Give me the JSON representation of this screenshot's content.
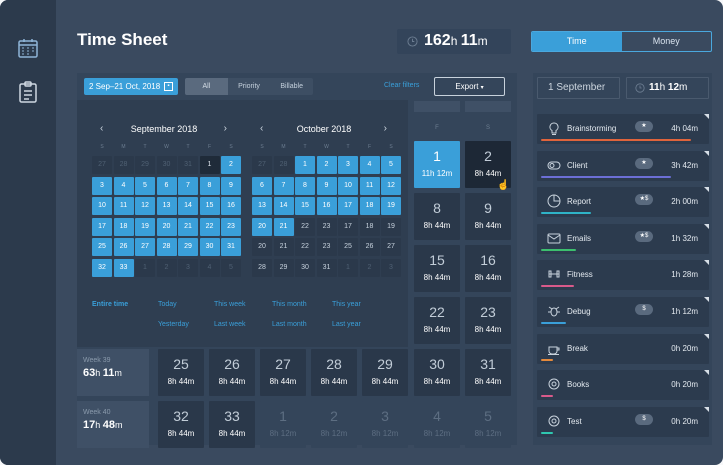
{
  "title": "Time Sheet",
  "total": {
    "hours": "162",
    "minutes": "11"
  },
  "view_toggle": {
    "time": "Time",
    "money": "Money"
  },
  "toolbar": {
    "date_range": "2 Sep–21 Oct, 2018",
    "filters": [
      "All",
      "Priority",
      "Billable"
    ],
    "clear": "Clear filters",
    "export": "Export"
  },
  "cal1": {
    "title": "September 2018",
    "dow": [
      "S",
      "M",
      "T",
      "W",
      "T",
      "F",
      "S"
    ],
    "days": [
      [
        "27",
        "m"
      ],
      [
        "28",
        "m"
      ],
      [
        "29",
        "m"
      ],
      [
        "30",
        "m"
      ],
      [
        "31",
        "m"
      ],
      [
        "1",
        "dk"
      ],
      [
        "2",
        "b"
      ],
      [
        "3",
        "b"
      ],
      [
        "4",
        "b"
      ],
      [
        "5",
        "b"
      ],
      [
        "6",
        "b"
      ],
      [
        "7",
        "b"
      ],
      [
        "8",
        "b"
      ],
      [
        "9",
        "b"
      ],
      [
        "10",
        "b"
      ],
      [
        "11",
        "b"
      ],
      [
        "12",
        "b"
      ],
      [
        "13",
        "b"
      ],
      [
        "14",
        "b"
      ],
      [
        "15",
        "b"
      ],
      [
        "16",
        "b"
      ],
      [
        "17",
        "b"
      ],
      [
        "18",
        "b"
      ],
      [
        "19",
        "b"
      ],
      [
        "20",
        "b"
      ],
      [
        "21",
        "b"
      ],
      [
        "22",
        "b"
      ],
      [
        "23",
        "b"
      ],
      [
        "25",
        "b"
      ],
      [
        "26",
        "b"
      ],
      [
        "27",
        "b"
      ],
      [
        "28",
        "b"
      ],
      [
        "29",
        "b"
      ],
      [
        "30",
        "b"
      ],
      [
        "31",
        "b"
      ],
      [
        "32",
        "b"
      ],
      [
        "33",
        "b"
      ],
      [
        "1",
        "m"
      ],
      [
        "2",
        "m"
      ],
      [
        "3",
        "m"
      ],
      [
        "4",
        "m"
      ],
      [
        "5",
        "m"
      ]
    ]
  },
  "cal2": {
    "title": "October 2018",
    "dow": [
      "S",
      "M",
      "T",
      "W",
      "T",
      "F",
      "S"
    ],
    "days": [
      [
        "27",
        "m"
      ],
      [
        "28",
        "m"
      ],
      [
        "1",
        "b"
      ],
      [
        "2",
        "b"
      ],
      [
        "3",
        "b"
      ],
      [
        "4",
        "b"
      ],
      [
        "5",
        "b"
      ],
      [
        "6",
        "b"
      ],
      [
        "7",
        "b"
      ],
      [
        "8",
        "b"
      ],
      [
        "9",
        "b"
      ],
      [
        "10",
        "b"
      ],
      [
        "11",
        "b"
      ],
      [
        "12",
        "b"
      ],
      [
        "13",
        "b"
      ],
      [
        "14",
        "b"
      ],
      [
        "15",
        "b"
      ],
      [
        "16",
        "b"
      ],
      [
        "17",
        "b"
      ],
      [
        "18",
        "b"
      ],
      [
        "19",
        "b"
      ],
      [
        "20",
        "b"
      ],
      [
        "21",
        "b"
      ],
      [
        "22",
        "n"
      ],
      [
        "23",
        "n"
      ],
      [
        "17",
        "n"
      ],
      [
        "18",
        "n"
      ],
      [
        "19",
        "n"
      ],
      [
        "20",
        "n"
      ],
      [
        "21",
        "n"
      ],
      [
        "22",
        "n"
      ],
      [
        "23",
        "n"
      ],
      [
        "25",
        "n"
      ],
      [
        "26",
        "n"
      ],
      [
        "27",
        "n"
      ],
      [
        "28",
        "n"
      ],
      [
        "29",
        "n"
      ],
      [
        "30",
        "n"
      ],
      [
        "31",
        "n"
      ],
      [
        "1",
        "m"
      ],
      [
        "2",
        "m"
      ],
      [
        "3",
        "m"
      ]
    ]
  },
  "quick": {
    "entire": "Entire time",
    "today": "Today",
    "yesterday": "Yesterday",
    "this_week": "This week",
    "last_week": "Last week",
    "this_month": "This month",
    "last_month": "Last month",
    "this_year": "This year",
    "last_year": "Last year"
  },
  "col_headers": [
    "F",
    "S"
  ],
  "day_cells": {
    "c1": {
      "n": "1",
      "h": "11h",
      "m": "12m"
    },
    "c2": {
      "n": "2",
      "h": "8h",
      "m": "44m"
    },
    "c8": {
      "n": "8",
      "h": "8h",
      "m": "44m"
    },
    "c9": {
      "n": "9",
      "h": "8h",
      "m": "44m"
    },
    "c15": {
      "n": "15",
      "h": "8h",
      "m": "44m"
    },
    "c16": {
      "n": "16",
      "h": "8h",
      "m": "44m"
    },
    "c22": {
      "n": "22",
      "h": "8h",
      "m": "44m"
    },
    "c23": {
      "n": "23",
      "h": "8h",
      "m": "44m"
    }
  },
  "weeks": [
    {
      "label": "Week 39",
      "total_h": "63",
      "total_m": "11",
      "days": [
        [
          "25",
          "8h",
          "44m"
        ],
        [
          "26",
          "8h",
          "44m"
        ],
        [
          "27",
          "8h",
          "44m"
        ],
        [
          "28",
          "8h",
          "44m"
        ],
        [
          "29",
          "8h",
          "44m"
        ],
        [
          "30",
          "8h",
          "44m"
        ],
        [
          "31",
          "8h",
          "44m"
        ]
      ]
    },
    {
      "label": "Week 40",
      "total_h": "17",
      "total_m": "48",
      "days": [
        [
          "32",
          "8h",
          "44m"
        ],
        [
          "33",
          "8h",
          "44m"
        ],
        [
          "1",
          "8h",
          "12m"
        ],
        [
          "2",
          "8h",
          "12m"
        ],
        [
          "3",
          "8h",
          "12m"
        ],
        [
          "4",
          "8h",
          "12m"
        ],
        [
          "5",
          "8h",
          "12m"
        ]
      ]
    }
  ],
  "right": {
    "date": "1 September",
    "total_h": "11",
    "total_m": "12"
  },
  "tasks": [
    {
      "name": "Brainstorming",
      "star": "★",
      "h": "4h",
      "m": "04m",
      "color": "#e0643c",
      "bar": 150
    },
    {
      "name": "Client",
      "star": "★",
      "h": "3h",
      "m": "42m",
      "color": "#6c6fd6",
      "bar": 130
    },
    {
      "name": "Report",
      "star": "★$",
      "h": "2h",
      "m": "00m",
      "color": "#2fb3c7",
      "bar": 50
    },
    {
      "name": "Emails",
      "star": "★$",
      "h": "1h",
      "m": "32m",
      "color": "#3cbf6e",
      "bar": 35
    },
    {
      "name": "Fitness",
      "star": "",
      "h": "1h",
      "m": "28m",
      "color": "#d85a8a",
      "bar": 33
    },
    {
      "name": "Debug",
      "star": "$",
      "h": "1h",
      "m": "12m",
      "color": "#3a9fd9",
      "bar": 25
    },
    {
      "name": "Break",
      "star": "",
      "h": "0h",
      "m": "20m",
      "color": "#e58a3c",
      "bar": 12
    },
    {
      "name": "Books",
      "star": "",
      "h": "0h",
      "m": "20m",
      "color": "#d85a8a",
      "bar": 12
    },
    {
      "name": "Test",
      "star": "$",
      "h": "0h",
      "m": "20m",
      "color": "#2fc7b0",
      "bar": 12
    }
  ]
}
